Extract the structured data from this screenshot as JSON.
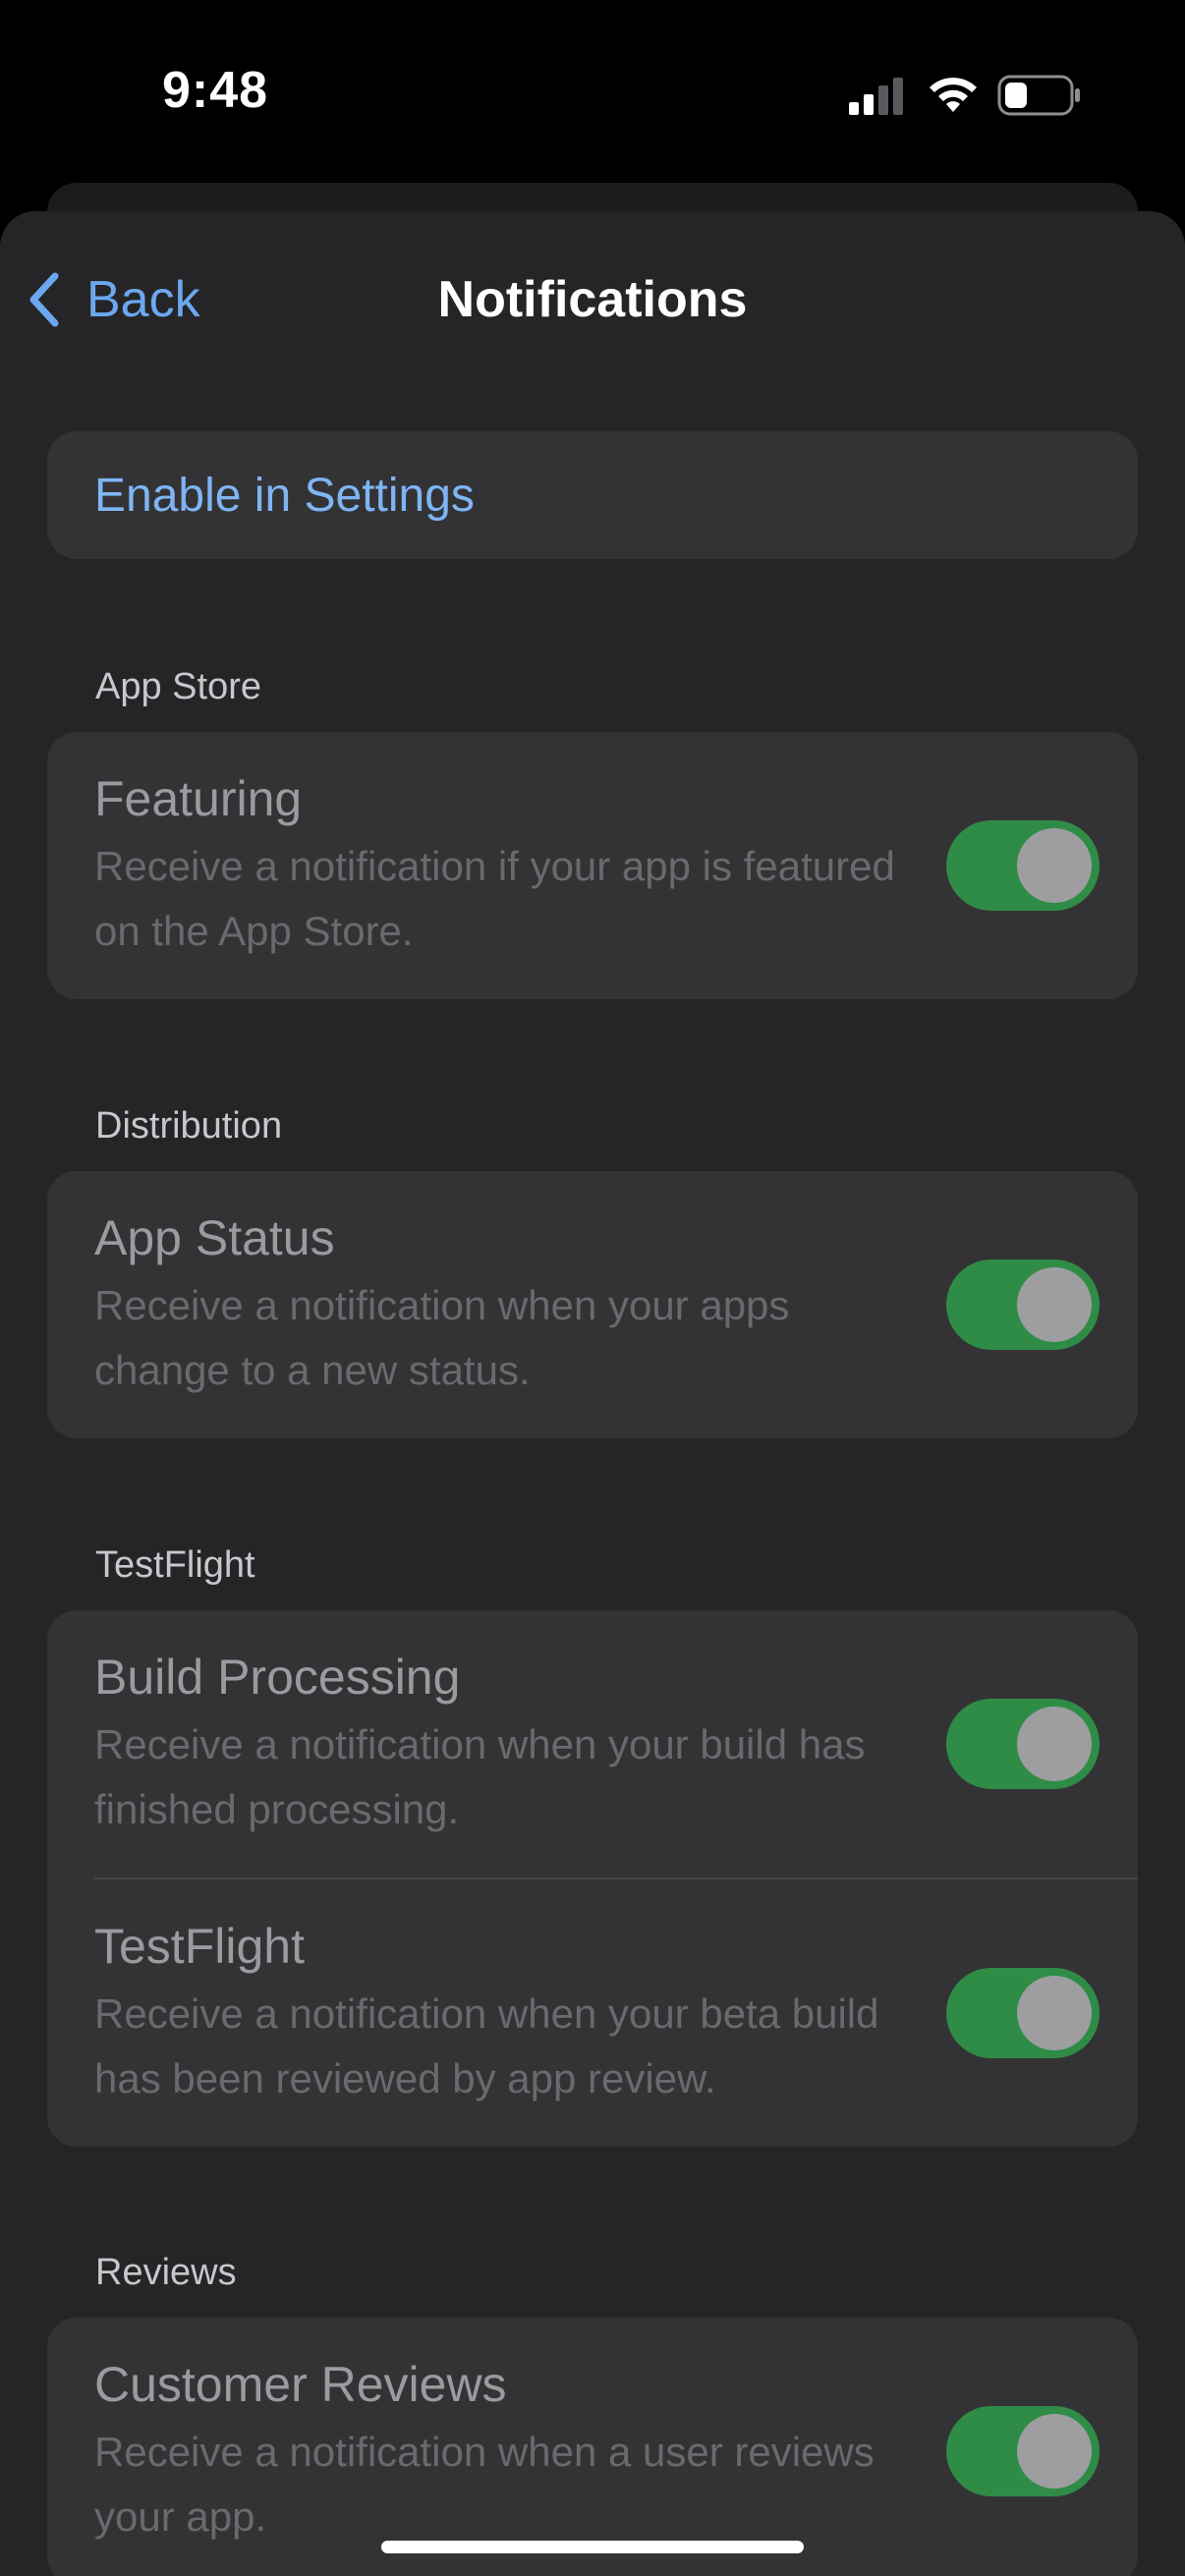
{
  "status_bar": {
    "time": "9:48",
    "icons": [
      "cellular-signal-icon",
      "wifi-icon",
      "battery-icon"
    ]
  },
  "nav": {
    "back_label": "Back",
    "title": "Notifications"
  },
  "enable_settings_label": "Enable in Settings",
  "sections": [
    {
      "header": "App Store",
      "rows": [
        {
          "title": "Featuring",
          "description": "Receive a notification if your app is featured on the App Store.",
          "enabled": true
        }
      ]
    },
    {
      "header": "Distribution",
      "rows": [
        {
          "title": "App Status",
          "description": "Receive a notification when your apps change to a new status.",
          "enabled": true
        }
      ]
    },
    {
      "header": "TestFlight",
      "rows": [
        {
          "title": "Build Processing",
          "description": "Receive a notification when your build has finished processing.",
          "enabled": true
        },
        {
          "title": "TestFlight",
          "description": "Receive a notification when your beta build has been reviewed by app review.",
          "enabled": true
        }
      ]
    },
    {
      "header": "Reviews",
      "rows": [
        {
          "title": "Customer Reviews",
          "description": "Receive a notification when a user reviews your app.",
          "enabled": true
        }
      ]
    }
  ],
  "colors": {
    "accent_blue": "#6ca8f0",
    "toggle_on": "#2f8c46",
    "sheet_bg": "#252527",
    "card_bg": "#333335"
  }
}
